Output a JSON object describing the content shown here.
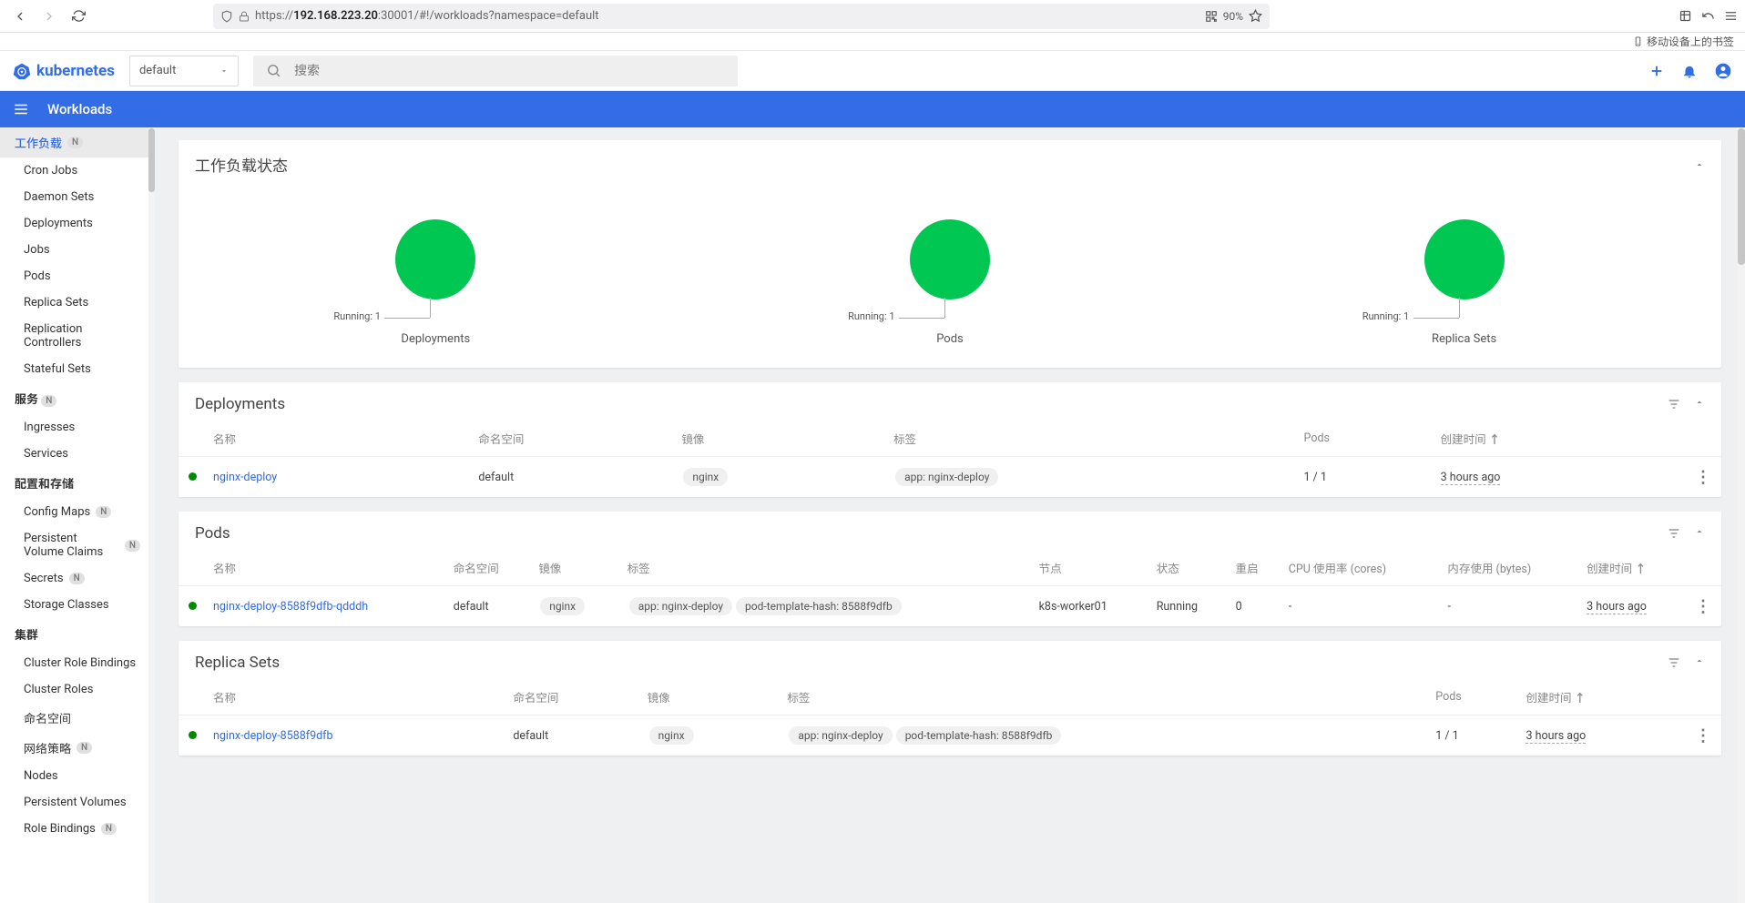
{
  "browser": {
    "url_prefix": "https://",
    "url_host": "192.168.223.20",
    "url_path": ":30001/#!/workloads?namespace=default",
    "zoom": "90%",
    "bookmark_label": "移动设备上的书签"
  },
  "header": {
    "brand": "kubernetes",
    "namespace": "default",
    "search_placeholder": "搜索"
  },
  "bluebar": {
    "title": "Workloads"
  },
  "sidebar": {
    "workloads": {
      "title": "工作负载",
      "badge": "N",
      "items": [
        "Cron Jobs",
        "Daemon Sets",
        "Deployments",
        "Jobs",
        "Pods",
        "Replica Sets",
        "Replication Controllers",
        "Stateful Sets"
      ]
    },
    "services": {
      "title": "服务",
      "badge": "N",
      "items": [
        "Ingresses",
        "Services"
      ]
    },
    "configstorage": {
      "title": "配置和存储",
      "items": [
        {
          "label": "Config Maps",
          "badge": "N"
        },
        {
          "label": "Persistent Volume Claims",
          "badge": "N"
        },
        {
          "label": "Secrets",
          "badge": "N"
        },
        {
          "label": "Storage Classes",
          "badge": ""
        }
      ]
    },
    "cluster": {
      "title": "集群",
      "items": [
        {
          "label": "Cluster Role Bindings",
          "badge": ""
        },
        {
          "label": "Cluster Roles",
          "badge": ""
        },
        {
          "label": "命名空间",
          "badge": ""
        },
        {
          "label": "网络策略",
          "badge": "N"
        },
        {
          "label": "Nodes",
          "badge": ""
        },
        {
          "label": "Persistent Volumes",
          "badge": ""
        },
        {
          "label": "Role Bindings",
          "badge": "N"
        }
      ]
    }
  },
  "status": {
    "title": "工作负载状态",
    "running_label": "Running: 1",
    "items": [
      "Deployments",
      "Pods",
      "Replica Sets"
    ]
  },
  "deployments": {
    "title": "Deployments",
    "cols": {
      "name": "名称",
      "ns": "命名空间",
      "image": "镜像",
      "labels": "标签",
      "pods": "Pods",
      "created": "创建时间"
    },
    "rows": [
      {
        "name": "nginx-deploy",
        "ns": "default",
        "image": "nginx",
        "labels": [
          "app: nginx-deploy"
        ],
        "pods": "1 / 1",
        "created": "3 hours ago"
      }
    ]
  },
  "pods": {
    "title": "Pods",
    "cols": {
      "name": "名称",
      "ns": "命名空间",
      "image": "镜像",
      "labels": "标签",
      "node": "节点",
      "status": "状态",
      "restarts": "重启",
      "cpu": "CPU 使用率 (cores)",
      "mem": "内存使用 (bytes)",
      "created": "创建时间"
    },
    "rows": [
      {
        "name": "nginx-deploy-8588f9dfb-qdddh",
        "ns": "default",
        "image": "nginx",
        "labels": [
          "app: nginx-deploy",
          "pod-template-hash: 8588f9dfb"
        ],
        "node": "k8s-worker01",
        "status": "Running",
        "restarts": "0",
        "cpu": "-",
        "mem": "-",
        "created": "3 hours ago"
      }
    ]
  },
  "replicasets": {
    "title": "Replica Sets",
    "cols": {
      "name": "名称",
      "ns": "命名空间",
      "image": "镜像",
      "labels": "标签",
      "pods": "Pods",
      "created": "创建时间"
    },
    "rows": [
      {
        "name": "nginx-deploy-8588f9dfb",
        "ns": "default",
        "image": "nginx",
        "labels": [
          "app: nginx-deploy",
          "pod-template-hash: 8588f9dfb"
        ],
        "pods": "1 / 1",
        "created": "3 hours ago"
      }
    ]
  },
  "chart_data": [
    {
      "type": "pie",
      "title": "Deployments",
      "series": [
        {
          "name": "Running",
          "value": 1
        }
      ],
      "total": 1
    },
    {
      "type": "pie",
      "title": "Pods",
      "series": [
        {
          "name": "Running",
          "value": 1
        }
      ],
      "total": 1
    },
    {
      "type": "pie",
      "title": "Replica Sets",
      "series": [
        {
          "name": "Running",
          "value": 1
        }
      ],
      "total": 1
    }
  ]
}
